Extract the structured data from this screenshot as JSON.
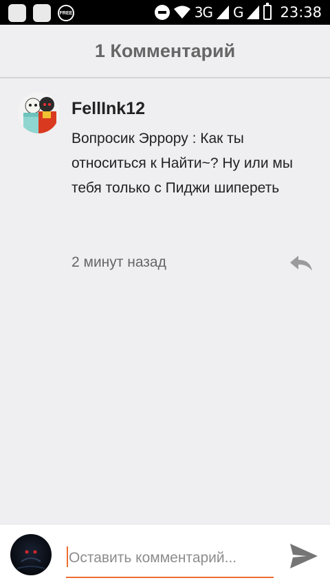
{
  "status_bar": {
    "free_badge": "FREE",
    "network_3g": "3G",
    "network_g": "G",
    "time": "23:38",
    "icons": [
      "app-square-icon",
      "app-square-icon",
      "free-badge-icon",
      "do-not-disturb-icon",
      "wifi-icon",
      "signal-icon",
      "battery-charging-icon"
    ]
  },
  "header": {
    "title": "1 Комментарий"
  },
  "comments": [
    {
      "author": "FellInk12",
      "text": "Вопросик Эррору : Как ты относиться к Найти~? Ну или мы тебя только с Пиджи шипереть",
      "time": "2 минут назад",
      "reply_icon": "reply-icon"
    }
  ],
  "input_bar": {
    "placeholder": "Оставить комментарий...",
    "value": "",
    "send_icon": "send-icon"
  },
  "colors": {
    "accent": "#ee6d2e",
    "background": "#efeef0",
    "header_text": "#666666",
    "muted_icon": "#9a9a9a"
  }
}
